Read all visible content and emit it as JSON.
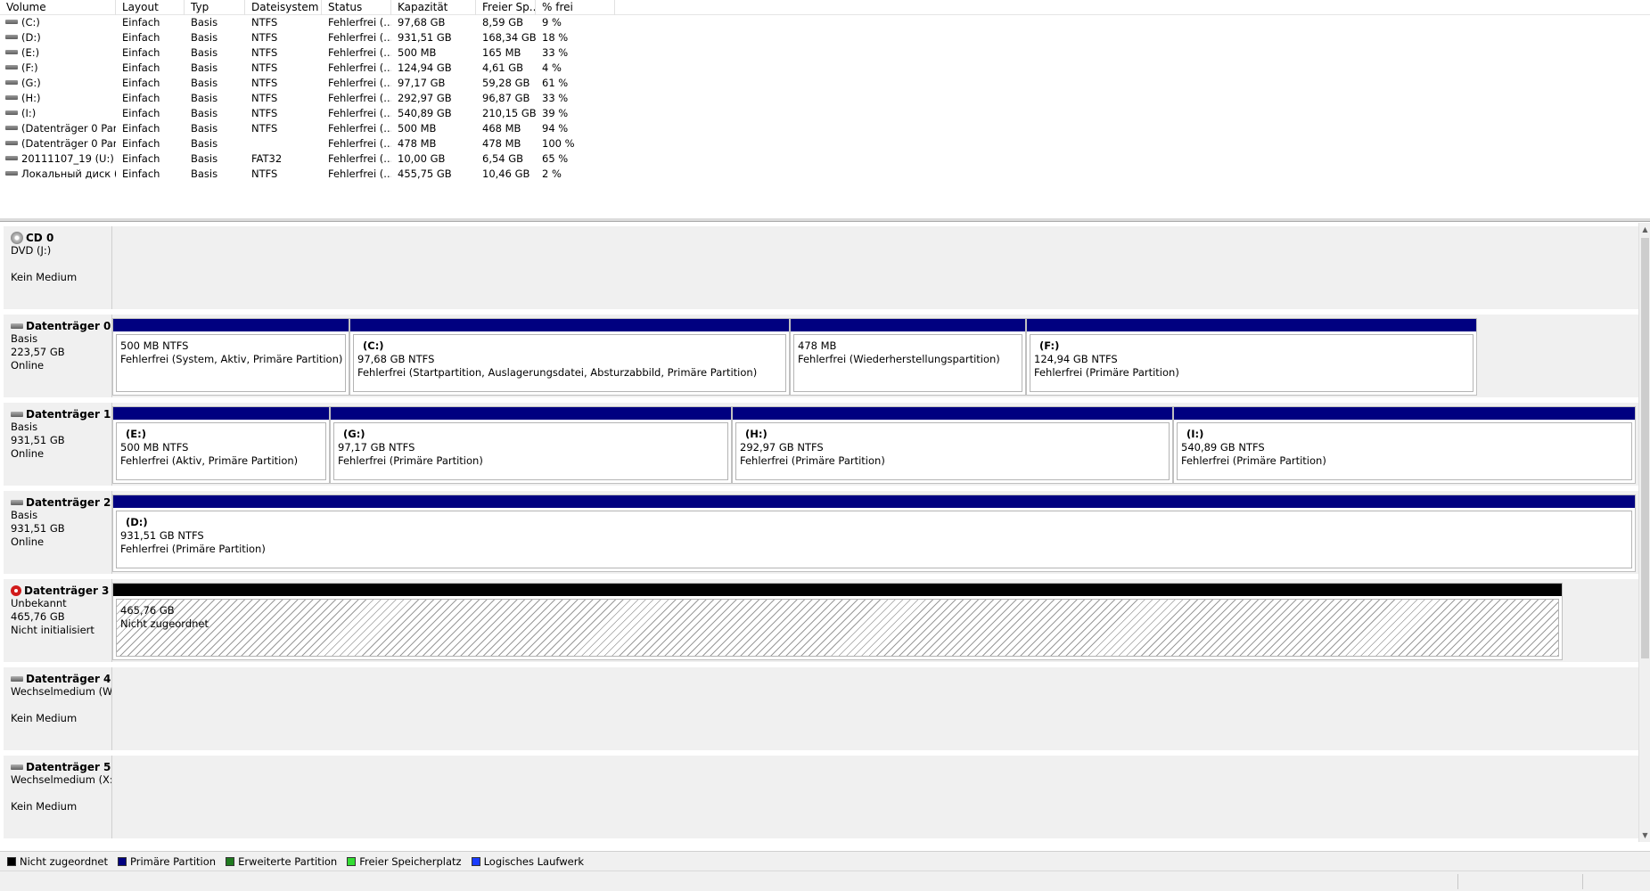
{
  "volume_list": {
    "columns": [
      "Volume",
      "Layout",
      "Typ",
      "Dateisystem",
      "Status",
      "Kapazität",
      "Freier Sp...",
      "% frei"
    ],
    "rows": [
      [
        "(C:)",
        "Einfach",
        "Basis",
        "NTFS",
        "Fehlerfrei (...",
        "97,68 GB",
        "8,59 GB",
        "9 %"
      ],
      [
        "(D:)",
        "Einfach",
        "Basis",
        "NTFS",
        "Fehlerfrei (...",
        "931,51 GB",
        "168,34 GB",
        "18 %"
      ],
      [
        "(E:)",
        "Einfach",
        "Basis",
        "NTFS",
        "Fehlerfrei (...",
        "500 MB",
        "165 MB",
        "33 %"
      ],
      [
        "(F:)",
        "Einfach",
        "Basis",
        "NTFS",
        "Fehlerfrei (...",
        "124,94 GB",
        "4,61 GB",
        "4 %"
      ],
      [
        "(G:)",
        "Einfach",
        "Basis",
        "NTFS",
        "Fehlerfrei (...",
        "97,17 GB",
        "59,28 GB",
        "61 %"
      ],
      [
        "(H:)",
        "Einfach",
        "Basis",
        "NTFS",
        "Fehlerfrei (...",
        "292,97 GB",
        "96,87 GB",
        "33 %"
      ],
      [
        "(I:)",
        "Einfach",
        "Basis",
        "NTFS",
        "Fehlerfrei (...",
        "540,89 GB",
        "210,15 GB",
        "39 %"
      ],
      [
        "(Datenträger 0 Par...",
        "Einfach",
        "Basis",
        "NTFS",
        "Fehlerfrei (...",
        "500 MB",
        "468 MB",
        "94 %"
      ],
      [
        "(Datenträger 0 Par...",
        "Einfach",
        "Basis",
        "",
        "Fehlerfrei (...",
        "478 MB",
        "478 MB",
        "100 %"
      ],
      [
        "20111107_19 (U:)",
        "Einfach",
        "Basis",
        "FAT32",
        "Fehlerfrei (...",
        "10,00 GB",
        "6,54 GB",
        "65 %"
      ],
      [
        "Локальный диск (...",
        "Einfach",
        "Basis",
        "NTFS",
        "Fehlerfrei (...",
        "455,75 GB",
        "10,46 GB",
        "2 %"
      ]
    ]
  },
  "disks": {
    "cd0": {
      "name": "CD 0",
      "line1": "DVD (J:)",
      "line2": "Kein Medium"
    },
    "d0": {
      "name": "Datenträger 0",
      "line1": "Basis",
      "line2": "223,57 GB",
      "line3": "Online",
      "partitions": [
        {
          "title": "",
          "size": "500 MB NTFS",
          "status": "Fehlerfrei (System, Aktiv, Primäre Partition)"
        },
        {
          "title": "(C:)",
          "size": "97,68 GB NTFS",
          "status": "Fehlerfrei (Startpartition, Auslagerungsdatei, Absturzabbild, Primäre Partition)"
        },
        {
          "title": "",
          "size": "478 MB",
          "status": "Fehlerfrei (Wiederherstellungspartition)"
        },
        {
          "title": "(F:)",
          "size": "124,94 GB NTFS",
          "status": "Fehlerfrei (Primäre Partition)"
        }
      ]
    },
    "d1": {
      "name": "Datenträger 1",
      "line1": "Basis",
      "line2": "931,51 GB",
      "line3": "Online",
      "partitions": [
        {
          "title": "(E:)",
          "size": "500 MB NTFS",
          "status": "Fehlerfrei (Aktiv, Primäre Partition)"
        },
        {
          "title": "(G:)",
          "size": "97,17 GB NTFS",
          "status": "Fehlerfrei (Primäre Partition)"
        },
        {
          "title": "(H:)",
          "size": "292,97 GB NTFS",
          "status": "Fehlerfrei (Primäre Partition)"
        },
        {
          "title": "(I:)",
          "size": "540,89 GB NTFS",
          "status": "Fehlerfrei (Primäre Partition)"
        }
      ]
    },
    "d2": {
      "name": "Datenträger 2",
      "line1": "Basis",
      "line2": "931,51 GB",
      "line3": "Online",
      "partitions": [
        {
          "title": "(D:)",
          "size": "931,51 GB NTFS",
          "status": "Fehlerfrei (Primäre Partition)"
        }
      ]
    },
    "d3": {
      "name": "Datenträger 3",
      "line1": "Unbekannt",
      "line2": "465,76 GB",
      "line3": "Nicht initialisiert",
      "partitions": [
        {
          "title": "",
          "size": "465,76 GB",
          "status": "Nicht zugeordnet"
        }
      ]
    },
    "d4": {
      "name": "Datenträger 4",
      "line1": "Wechselmedium (W",
      "line2": "Kein Medium"
    },
    "d5": {
      "name": "Datenträger 5",
      "line1": "Wechselmedium (X:",
      "line2": "Kein Medium"
    }
  },
  "legend": [
    {
      "label": "Nicht zugeordnet",
      "color": "#000000"
    },
    {
      "label": "Primäre Partition",
      "color": "#000080"
    },
    {
      "label": "Erweiterte Partition",
      "color": "#1f7a1f"
    },
    {
      "label": "Freier Speicherplatz",
      "color": "#33dd33"
    },
    {
      "label": "Logisches Laufwerk",
      "color": "#1a3cff"
    }
  ],
  "icons": {
    "volume": "drive-icon",
    "disk": "hard-disk-icon",
    "cd": "cd-drive-icon",
    "error": "error-icon"
  }
}
